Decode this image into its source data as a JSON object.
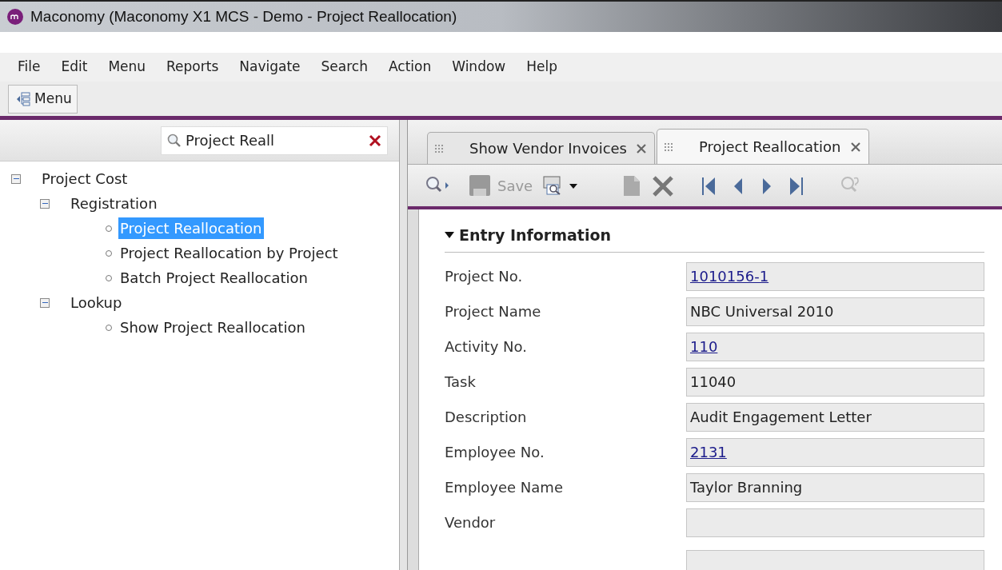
{
  "window": {
    "title": "Maconomy (Maconomy X1 MCS - Demo - Project Reallocation)"
  },
  "menu_bar": [
    "File",
    "Edit",
    "Menu",
    "Reports",
    "Navigate",
    "Search",
    "Action",
    "Window",
    "Help"
  ],
  "toolbar": {
    "menu_button": "Menu"
  },
  "sidebar": {
    "search": {
      "value": "Project Reall"
    },
    "tree": [
      {
        "label": "Project Cost",
        "expanded": true,
        "children": [
          {
            "label": "Registration",
            "expanded": true,
            "children": [
              {
                "label": "Project Reallocation",
                "selected": true
              },
              {
                "label": "Project Reallocation by Project",
                "selected": false
              },
              {
                "label": "Batch Project Reallocation",
                "selected": false
              }
            ]
          },
          {
            "label": "Lookup",
            "expanded": true,
            "children": [
              {
                "label": "Show Project Reallocation",
                "selected": false
              }
            ]
          }
        ]
      }
    ]
  },
  "tabs": [
    {
      "label": "Show Vendor Invoices",
      "selected": false
    },
    {
      "label": "Project Reallocation",
      "selected": true
    }
  ],
  "form_toolbar": {
    "save_label": "Save",
    "save_disabled": true
  },
  "section": {
    "title": "Entry Information",
    "expanded": true
  },
  "fields": [
    {
      "label": "Project No.",
      "value": "1010156-1",
      "link": true
    },
    {
      "label": "Project Name",
      "value": "NBC Universal 2010",
      "link": false
    },
    {
      "label": "Activity No.",
      "value": "110",
      "link": true
    },
    {
      "label": "Task",
      "value": "11040",
      "link": false
    },
    {
      "label": "Description",
      "value": "Audit Engagement Letter",
      "link": false
    },
    {
      "label": "Employee No.",
      "value": "2131",
      "link": true
    },
    {
      "label": "Employee Name",
      "value": "Taylor Branning",
      "link": false
    },
    {
      "label": "Vendor"
    },
    {
      "kind": "clipped"
    }
  ]
}
